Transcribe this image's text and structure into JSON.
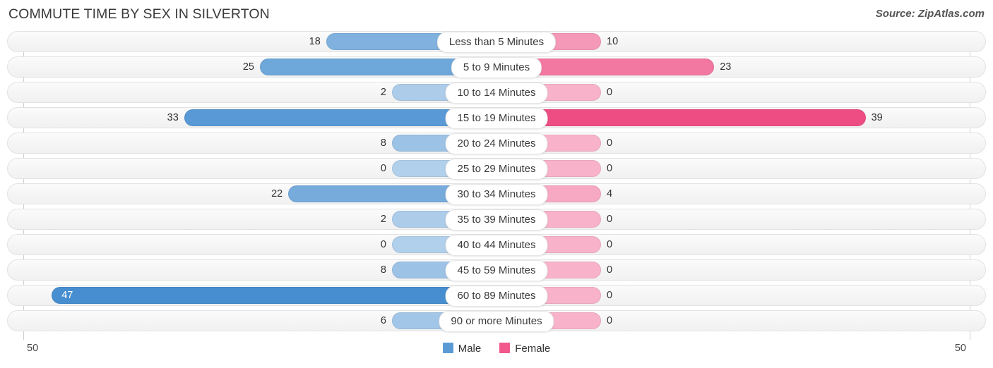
{
  "header": {
    "title": "COMMUTE TIME BY SEX IN SILVERTON",
    "source": "Source: ZipAtlas.com"
  },
  "legend": {
    "items": [
      {
        "label": "Male",
        "color": "#5b9bd5"
      },
      {
        "label": "Female",
        "color": "#f2588c"
      }
    ]
  },
  "axis": {
    "left_tick": "50",
    "right_tick": "50",
    "max": 50
  },
  "chart_data": {
    "type": "bar",
    "orientation": "horizontal-diverging",
    "title": "COMMUTE TIME BY SEX IN SILVERTON",
    "xlabel": "",
    "ylabel": "",
    "xlim": [
      50,
      50
    ],
    "grid": false,
    "legend_position": "bottom-center",
    "categories": [
      "Less than 5 Minutes",
      "5 to 9 Minutes",
      "10 to 14 Minutes",
      "15 to 19 Minutes",
      "20 to 24 Minutes",
      "25 to 29 Minutes",
      "30 to 34 Minutes",
      "35 to 39 Minutes",
      "40 to 44 Minutes",
      "45 to 59 Minutes",
      "60 to 89 Minutes",
      "90 or more Minutes"
    ],
    "series": [
      {
        "name": "Male",
        "color": "#5b9bd5",
        "values": [
          18,
          25,
          2,
          33,
          8,
          0,
          22,
          2,
          0,
          8,
          47,
          6
        ]
      },
      {
        "name": "Female",
        "color": "#f2588c",
        "values": [
          10,
          23,
          0,
          39,
          0,
          0,
          4,
          0,
          0,
          0,
          0,
          0
        ]
      }
    ]
  },
  "rows": [
    {
      "label": "Less than 5 Minutes",
      "male": "18",
      "female": "10"
    },
    {
      "label": "5 to 9 Minutes",
      "male": "25",
      "female": "23"
    },
    {
      "label": "10 to 14 Minutes",
      "male": "2",
      "female": "0"
    },
    {
      "label": "15 to 19 Minutes",
      "male": "33",
      "female": "39"
    },
    {
      "label": "20 to 24 Minutes",
      "male": "8",
      "female": "0"
    },
    {
      "label": "25 to 29 Minutes",
      "male": "0",
      "female": "0"
    },
    {
      "label": "30 to 34 Minutes",
      "male": "22",
      "female": "4"
    },
    {
      "label": "35 to 39 Minutes",
      "male": "2",
      "female": "0"
    },
    {
      "label": "40 to 44 Minutes",
      "male": "0",
      "female": "0"
    },
    {
      "label": "45 to 59 Minutes",
      "male": "8",
      "female": "0"
    },
    {
      "label": "60 to 89 Minutes",
      "male": "47",
      "female": "0"
    },
    {
      "label": "90 or more Minutes",
      "male": "6",
      "female": "0"
    }
  ]
}
